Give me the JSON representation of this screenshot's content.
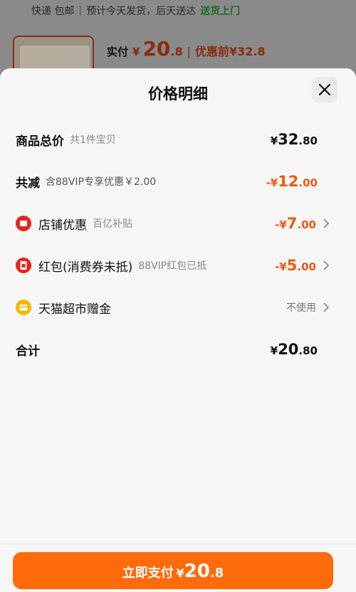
{
  "background": {
    "shipping_text": "快递 包邮",
    "shipping_separator": "|",
    "shipping_info": "预计今天发货，后天送达",
    "shipping_action": "送货上门",
    "actual_label": "实付",
    "currency": "¥",
    "actual_int": "20",
    "actual_dec": ".8",
    "bar": "|",
    "before_label": "优惠前¥32.8"
  },
  "sheet": {
    "title": "价格明细"
  },
  "rows": {
    "total": {
      "label": "商品总价",
      "sub": "共1件宝贝",
      "yen": "¥",
      "int": "32",
      "dec": ".80"
    },
    "reduce": {
      "label": "共减",
      "sub": "含88VIP专享优惠￥2.00",
      "minus": "-¥",
      "int": "12",
      "dec": ".00"
    },
    "store": {
      "label": "店铺优惠",
      "sub": "百亿补贴",
      "minus": "-¥",
      "int": "7",
      "dec": ".00",
      "icon": "store-coupon-icon"
    },
    "redpacket": {
      "label": "红包(消费券未抵)",
      "sub": "88VIP红包已抵",
      "minus": "-¥",
      "int": "5",
      "dec": ".00",
      "icon": "red-packet-icon"
    },
    "tmall": {
      "label": "天猫超市赠金",
      "value": "不使用",
      "icon": "gift-money-icon"
    },
    "sum": {
      "label": "合计",
      "yen": "¥",
      "int": "20",
      "dec": ".80"
    }
  },
  "pay_button": {
    "label": "立即支付",
    "yen": "¥",
    "int": "20",
    "dec": ".8"
  },
  "colors": {
    "accent": "#ff6a0a",
    "discount": "#f05a12",
    "sheet_bg": "#f6f6f6"
  }
}
